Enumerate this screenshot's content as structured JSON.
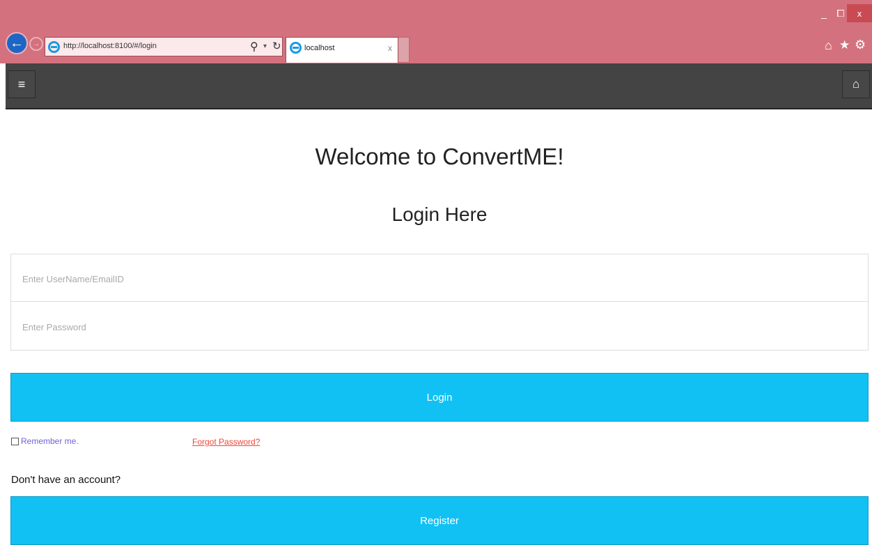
{
  "browser": {
    "address_url": "http://localhost:8100/#/login",
    "tab_title": "localhost",
    "window_controls": {
      "minimize": "_",
      "restore": "⧠",
      "close": "x"
    },
    "tab_close": "x",
    "icons": {
      "back": "arrow-left",
      "forward": "arrow-right",
      "site": "internet-explorer",
      "search": "magnifier",
      "refresh": "refresh",
      "home": "home",
      "favorites": "star",
      "tools": "gear"
    }
  },
  "appbar": {
    "menu_icon": "hamburger",
    "home_icon": "home",
    "background": "#444444"
  },
  "page": {
    "welcome": "Welcome to ConvertME!",
    "subtitle": "Login Here"
  },
  "form": {
    "username_placeholder": "Enter UserName/EmailID",
    "password_placeholder": "Enter Password",
    "username_value": "",
    "password_value": "",
    "login_label": "Login",
    "remember_label": "Remember me.",
    "remember_checked": false,
    "forgot_label": "Forgot Password?",
    "no_account_text": "Don't have an account?",
    "register_label": "Register"
  },
  "colors": {
    "chrome_bg": "#d4717e",
    "primary_button": "#11c1f3",
    "remember_text": "#6d62d9",
    "forgot_link": "#ef473a"
  }
}
